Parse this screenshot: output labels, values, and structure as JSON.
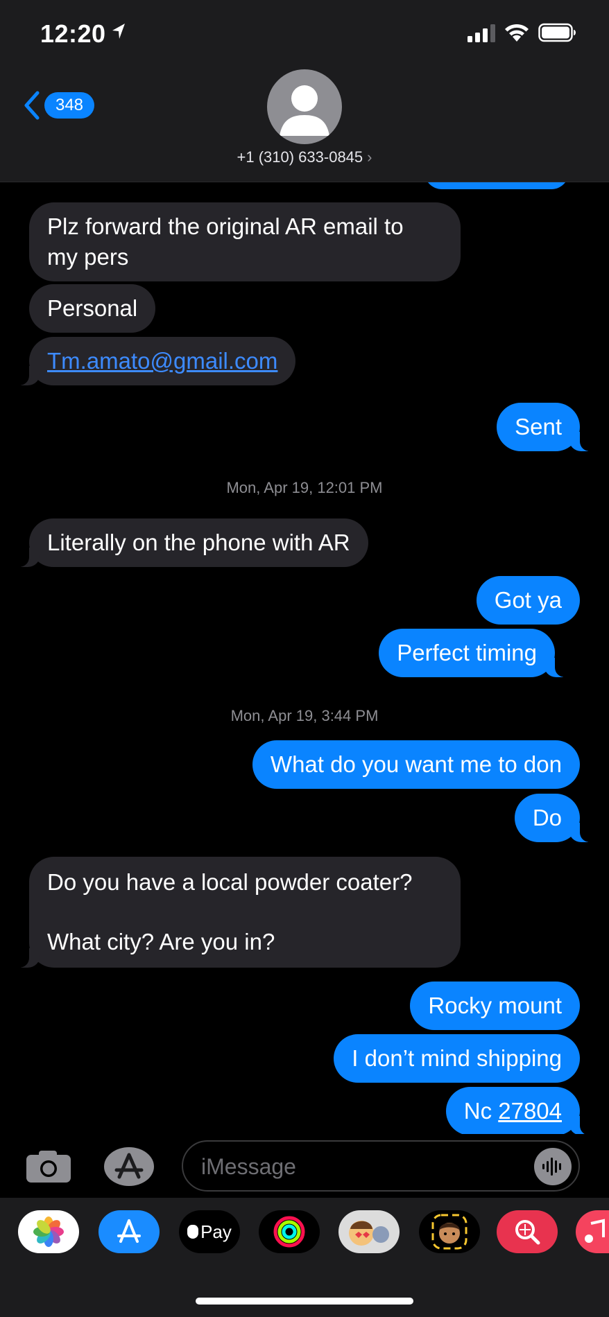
{
  "status_bar": {
    "time": "12:20"
  },
  "header": {
    "back_count": "348",
    "contact": "+1 (310) 633-0845",
    "contact_chevron": "›"
  },
  "messages": {
    "m1_line1": "Plz forward the original AR email to",
    "m1_line2": "my pers",
    "m2": "Personal",
    "m3": "Tm.amato@gmail.com",
    "m4": "Sent",
    "ts1": "Mon, Apr 19, 12:01 PM",
    "m5": "Literally on the phone with AR",
    "m6": "Got ya",
    "m7": "Perfect timing",
    "ts2": "Mon, Apr 19, 3:44 PM",
    "m8": "What do you want me to don",
    "m9": "Do",
    "m10_line1": "Do you have a local powder coater?",
    "m10_line2": "What city? Are you in?",
    "m11": "Rocky mount",
    "m12": "I don’t mind shipping",
    "m13_prefix": "Nc ",
    "m13_zip": "27804"
  },
  "input": {
    "placeholder": "iMessage"
  },
  "app_drawer": {
    "apple_pay_label": "Pay"
  },
  "colors": {
    "blue": "#0a84ff",
    "incoming": "#26252a",
    "background": "#000000"
  }
}
